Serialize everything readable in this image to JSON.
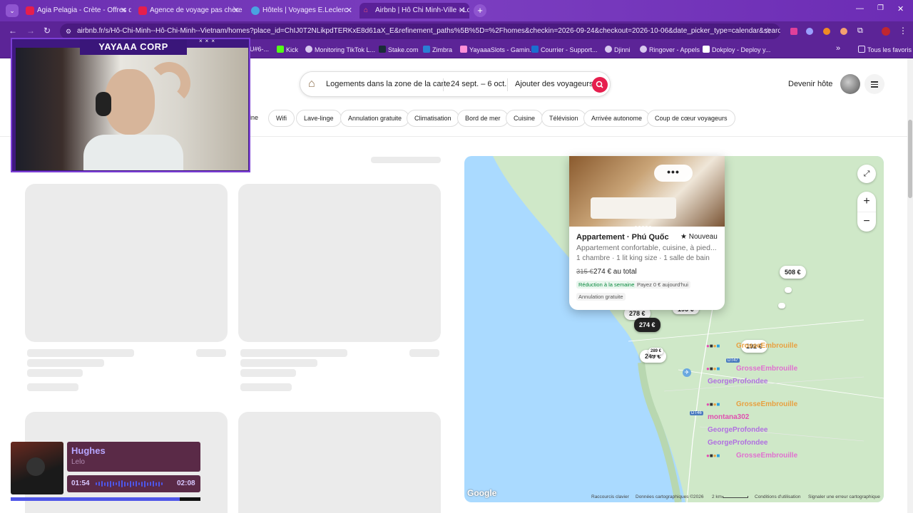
{
  "browser": {
    "tabs": [
      {
        "label": "Agia Pelagia - Crète - Offres de"
      },
      {
        "label": "Agence de voyage pas chère | V"
      },
      {
        "label": "Hôtels | Voyages E.Leclerc"
      },
      {
        "label": "Airbnb | Hô Chi Minh-Ville - Lo"
      }
    ],
    "url": "airbnb.fr/s/Hô-Chi-Minh--Hô-Chi-Minh--Vietnam/homes?place_id=ChIJ0T2NLikpdTERKxE8d61aX_E&refinement_paths%5B%5D=%2Fhomes&checkin=2026-09-24&checkout=2026-10-06&date_picker_type=calendar&search_type=...",
    "bookmarks": [
      "U#6-...",
      "Kick",
      "Monitoring TikTok L...",
      "Stake.com",
      "Zimbra",
      "YayaaaSlots - Gamin...",
      "Courrier - Support...",
      "Djinni",
      "Ringover - Appels",
      "Dokploy - Deploy y..."
    ],
    "bookmarks_more": "»",
    "all_bookmarks": "Tous les favoris"
  },
  "search": {
    "where": "Logements dans la zone de la carte",
    "dates": "24 sept. – 6 oct.",
    "guests": "Ajouter des voyageurs"
  },
  "header": {
    "become_host": "Devenir hôte"
  },
  "filters": [
    "ine",
    "Wifi",
    "Lave-linge",
    "Annulation gratuite",
    "Climatisation",
    "Bord de mer",
    "Cuisine",
    "Télévision",
    "Arrivée autonome",
    "Coup de cœur voyageurs"
  ],
  "card": {
    "title": "Appartement · Phú Quốc",
    "rating": "★ Nouveau",
    "desc": "Appartement confortable, cuisine, à pied...",
    "beds": "1 chambre · 1 lit king size · 1 salle de bain",
    "old_price": "315 €",
    "price": "274 € au total",
    "badge1": "Réduction à la semaine",
    "badge2": "Payez 0 € aujourd'hui",
    "badge3": "Annulation gratuite",
    "dots": "•••"
  },
  "map": {
    "prices": [
      "508 €",
      "278 €",
      "274 €",
      "195 €",
      "192 €",
      "249 €",
      "289 €"
    ],
    "roads": [
      "DT47",
      "DT46"
    ],
    "zoom_in": "+",
    "zoom_out": "−",
    "google": "Google",
    "footer": [
      "Raccourcis clavier",
      "Données cartographiques ©2026",
      "2 km",
      "Conditions d'utilisation",
      "Signaler une erreur cartographique"
    ]
  },
  "overlay": {
    "webcam_label": "YAYAAA CORP",
    "player": {
      "title": "Hughes",
      "artist": "Lelo",
      "elapsed": "01:54",
      "total": "02:08",
      "progress": 0.89
    },
    "chat": [
      {
        "user": "GrosseEmbrouille",
        "color": "#e8a040"
      },
      {
        "user": "GrosseEmbrouille",
        "color": "#e070d0"
      },
      {
        "user": "GeorgeProfondee",
        "color": "#b070e0"
      },
      {
        "user": "GrosseEmbrouille",
        "color": "#e8a040"
      },
      {
        "user": "montana302",
        "color": "#e050b0"
      },
      {
        "user": "GeorgeProfondee",
        "color": "#b070e0"
      },
      {
        "user": "GeorgeProfondee",
        "color": "#b070e0"
      },
      {
        "user": "GrosseEmbrouille",
        "color": "#e070d0"
      }
    ]
  }
}
